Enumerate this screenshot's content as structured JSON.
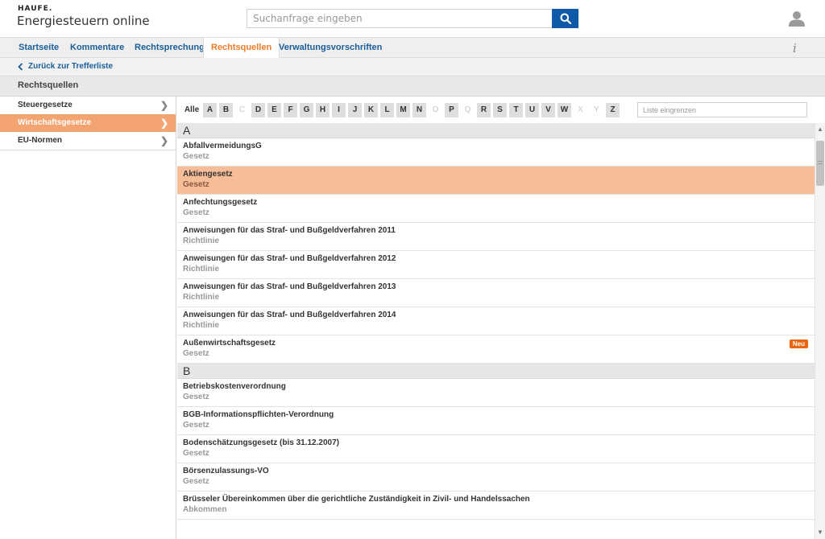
{
  "header": {
    "logo": "HAUFE.",
    "app_title": "Energiesteuern online",
    "search_placeholder": "Suchanfrage eingeben"
  },
  "nav": {
    "tabs": [
      {
        "label": "Startseite"
      },
      {
        "label": "Kommentare"
      },
      {
        "label": "Rechtsprechung"
      },
      {
        "label": "Rechtsquellen",
        "active": true
      },
      {
        "label": "Verwaltungsvorschriften"
      }
    ],
    "info_label": "i"
  },
  "back": {
    "label": "Zurück zur Trefferliste"
  },
  "section": {
    "title": "Rechtsquellen"
  },
  "sidebar": {
    "items": [
      {
        "label": "Steuergesetze"
      },
      {
        "label": "Wirtschaftsgesetze",
        "active": true
      },
      {
        "label": "EU-Normen"
      }
    ]
  },
  "letters": {
    "all_label": "Alle",
    "items": [
      {
        "l": "A",
        "enabled": true
      },
      {
        "l": "B",
        "enabled": true
      },
      {
        "l": "C",
        "enabled": false
      },
      {
        "l": "D",
        "enabled": true
      },
      {
        "l": "E",
        "enabled": true
      },
      {
        "l": "F",
        "enabled": true
      },
      {
        "l": "G",
        "enabled": true
      },
      {
        "l": "H",
        "enabled": true
      },
      {
        "l": "I",
        "enabled": true
      },
      {
        "l": "J",
        "enabled": true
      },
      {
        "l": "K",
        "enabled": true
      },
      {
        "l": "L",
        "enabled": true
      },
      {
        "l": "M",
        "enabled": true
      },
      {
        "l": "N",
        "enabled": true
      },
      {
        "l": "O",
        "enabled": false
      },
      {
        "l": "P",
        "enabled": true
      },
      {
        "l": "Q",
        "enabled": false
      },
      {
        "l": "R",
        "enabled": true
      },
      {
        "l": "S",
        "enabled": true
      },
      {
        "l": "T",
        "enabled": true
      },
      {
        "l": "U",
        "enabled": true
      },
      {
        "l": "V",
        "enabled": true
      },
      {
        "l": "W",
        "enabled": true
      },
      {
        "l": "X",
        "enabled": false
      },
      {
        "l": "Y",
        "enabled": false
      },
      {
        "l": "Z",
        "enabled": true
      }
    ],
    "filter_placeholder": "Liste eingrenzen"
  },
  "groups": [
    {
      "letter": "A",
      "entries": [
        {
          "title": "AbfallvermeidungsG",
          "type": "Gesetz"
        },
        {
          "title": "Aktiengesetz",
          "type": "Gesetz",
          "selected": true
        },
        {
          "title": "Anfechtungsgesetz",
          "type": "Gesetz"
        },
        {
          "title": "Anweisungen für das Straf- und Bußgeldverfahren 2011",
          "type": "Richtlinie"
        },
        {
          "title": "Anweisungen für das Straf- und Bußgeldverfahren 2012",
          "type": "Richtlinie"
        },
        {
          "title": "Anweisungen für das Straf- und Bußgeldverfahren 2013",
          "type": "Richtlinie"
        },
        {
          "title": "Anweisungen für das Straf- und Bußgeldverfahren 2014",
          "type": "Richtlinie"
        },
        {
          "title": "Außenwirtschaftsgesetz",
          "type": "Gesetz",
          "badge": "Neu"
        }
      ]
    },
    {
      "letter": "B",
      "entries": [
        {
          "title": "Betriebskostenverordnung",
          "type": "Gesetz"
        },
        {
          "title": "BGB-Informationspflichten-Verordnung",
          "type": "Gesetz"
        },
        {
          "title": "Bodenschätzungsgesetz (bis 31.12.2007)",
          "type": "Gesetz"
        },
        {
          "title": "Börsenzulassungs-VO",
          "type": "Gesetz"
        },
        {
          "title": "Brüsseler Übereinkommen über die gerichtliche Zuständigkeit in Zivil- und Handelssachen",
          "type": "Abkommen"
        }
      ]
    }
  ],
  "colors": {
    "accent": "#f07c26",
    "selected_row": "#f7bc98",
    "sidebar_active": "#f4a471",
    "link": "#1a5e9a",
    "search_button": "#0f5aa8",
    "badge": "#e8650e"
  }
}
